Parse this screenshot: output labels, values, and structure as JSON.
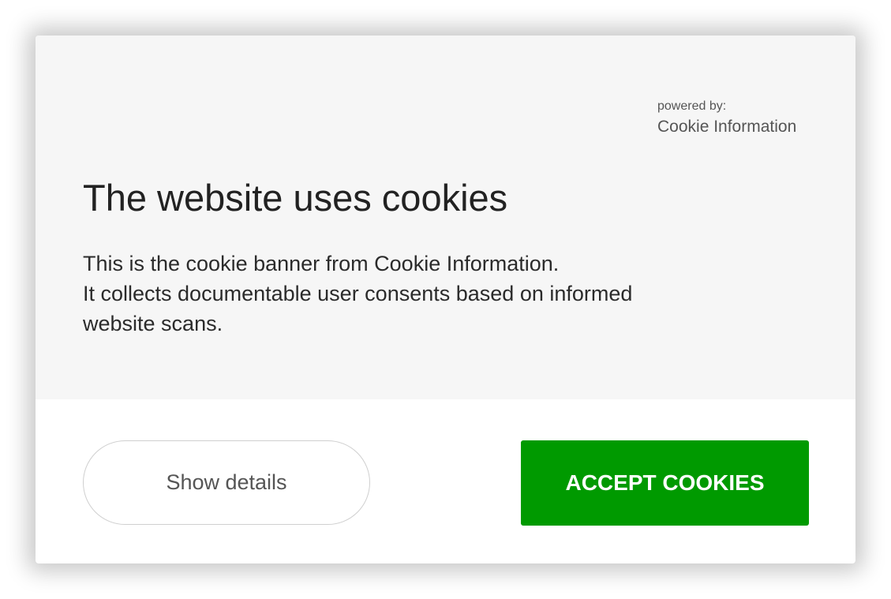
{
  "banner": {
    "powered_by_label": "powered by:",
    "powered_by_brand": "Cookie Information",
    "title": "The website uses cookies",
    "description_lines": [
      "This is the cookie banner from Cookie Information.",
      "It collects documentable user consents based on informed",
      "website scans."
    ],
    "show_details_label": "Show details",
    "accept_label": "ACCEPT COOKIES"
  },
  "colors": {
    "accent": "#009a00",
    "top_background": "#f6f6f6",
    "bottom_background": "#ffffff",
    "title_text": "#222222"
  }
}
